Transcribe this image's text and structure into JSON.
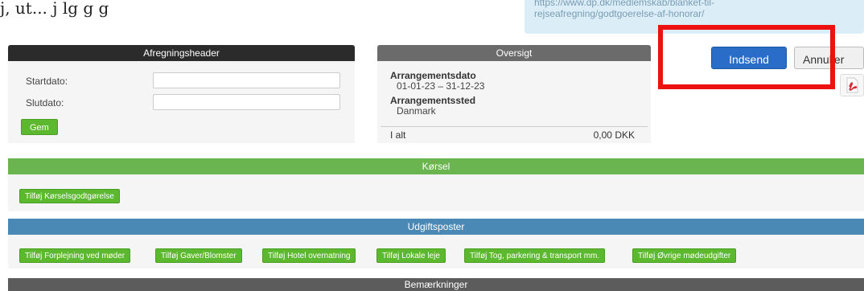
{
  "top_fragment": "j, ut...  j    lg  g  g  ",
  "info_box": {
    "link_line1": "https://www.dp.dk/medlemskab/blanket-til-",
    "link_line2": "rejseafregning/godtgoerelse-af-honorar/"
  },
  "afregningsheader": {
    "title": "Afregningsheader",
    "startdato_label": "Startdato:",
    "startdato_value": "",
    "slutdato_label": "Slutdato:",
    "slutdato_value": "",
    "save_label": "Gem"
  },
  "oversigt": {
    "title": "Oversigt",
    "arrangementsdato_label": "Arrangementsdato",
    "arrangementsdato_value": "01-01-23 – 31-12-23",
    "arrangementssted_label": "Arrangementssted",
    "arrangementssted_value": "Danmark",
    "total_label": "I alt",
    "total_value": "0,00 DKK"
  },
  "actions": {
    "submit_label": "Indsend",
    "cancel_label": "Annuller",
    "pdf_icon": "pdf-icon"
  },
  "korsel": {
    "title": "Kørsel",
    "add_label": "Tilføj Kørselsgodtgørelse"
  },
  "udgiftsposter": {
    "title": "Udgiftsposter",
    "buttons": [
      "Tilføj Forplejning ved møder",
      "Tilføj Gaver/Blomster",
      "Tilføj Hotel overnatning",
      "Tilføj Lokale leje",
      "Tilføj Tog, parkering & transport mm.",
      "Tilføj Øvrige mødeudgifter"
    ]
  },
  "bemaerkninger": {
    "title": "Bemærkninger"
  },
  "colors": {
    "highlight": "#ee1111",
    "primary": "#2a6dc9",
    "green": "#5cb82e",
    "korsel_bar": "#6ab550",
    "udgift_bar": "#4a88b5"
  }
}
